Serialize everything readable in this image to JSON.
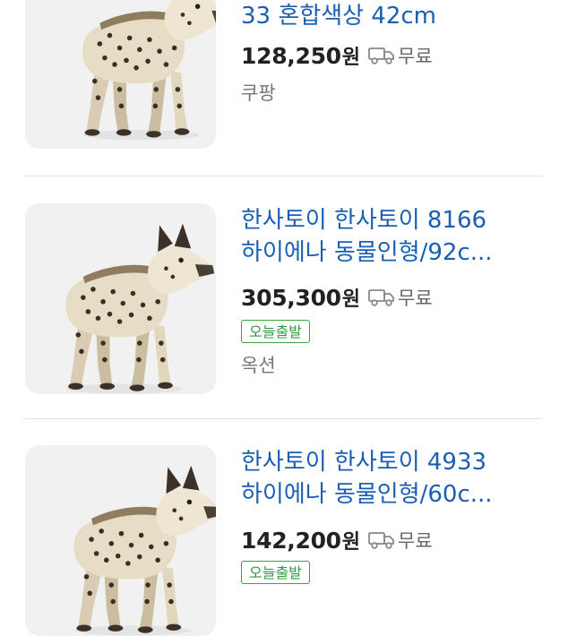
{
  "items": [
    {
      "title_lines": [
        "33 혼합색상 42cm"
      ],
      "price": "128,250",
      "currency": "원",
      "shipping": "무료",
      "seller": "쿠팡",
      "image": "hyena-plush-toy"
    },
    {
      "title_lines": [
        "한사토이 한사토이 8166",
        "하이에나 동물인형/92c..."
      ],
      "price": "305,300",
      "currency": "원",
      "shipping": "무료",
      "badge": "오늘출발",
      "seller": "옥션",
      "image": "hyena-plush-toy"
    },
    {
      "title_lines": [
        "한사토이 한사토이 4933",
        "하이에나 동물인형/60c..."
      ],
      "price": "142,200",
      "currency": "원",
      "shipping": "무료",
      "badge": "오늘출발",
      "image": "hyena-plush-toy"
    }
  ],
  "colors": {
    "title": "#1a5fb4",
    "badge": "#2f9a40",
    "price": "#222222"
  }
}
